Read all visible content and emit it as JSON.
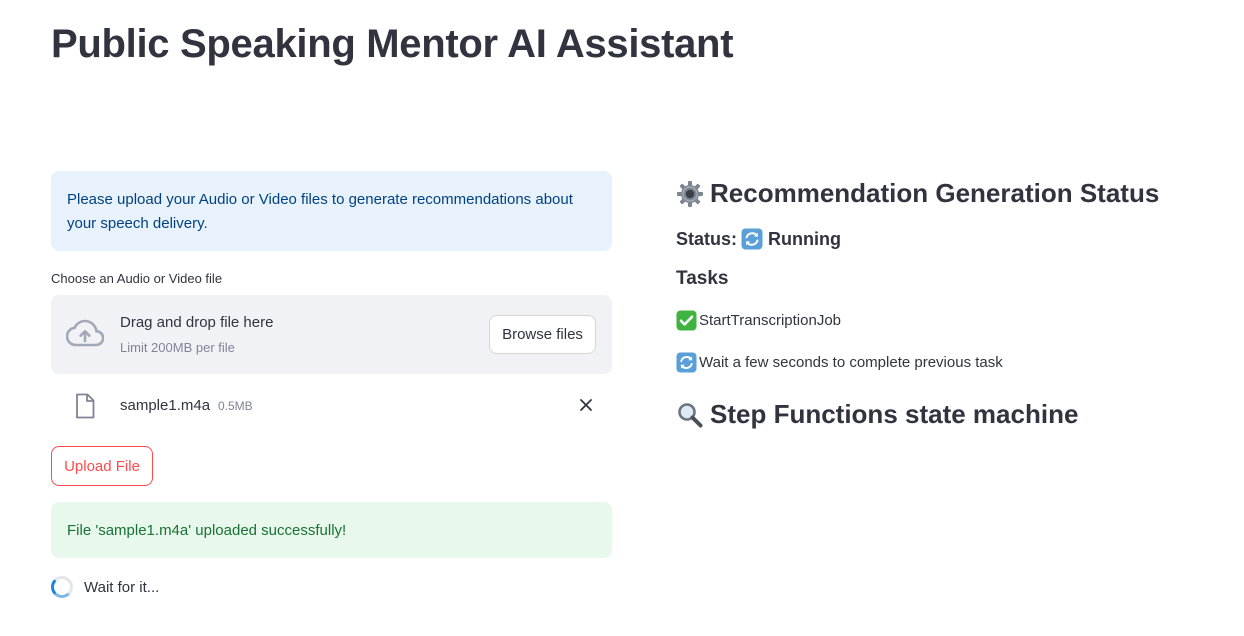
{
  "page": {
    "title": "Public Speaking Mentor AI Assistant"
  },
  "left": {
    "info_text": "Please upload your Audio or Video files to generate recommendations about your speech delivery.",
    "uploader_label": "Choose an Audio or Video file",
    "dropzone": {
      "title": "Drag and drop file here",
      "subtitle": "Limit 200MB per file",
      "browse_label": "Browse files",
      "icon": "cloud-upload-icon"
    },
    "file": {
      "name": "sample1.m4a",
      "size": "0.5MB",
      "icon": "file-icon"
    },
    "upload_button": "Upload File",
    "success_text": "File 'sample1.m4a' uploaded successfully!",
    "spinner_text": "Wait for it..."
  },
  "right": {
    "status_heading": "Recommendation Generation Status",
    "status_prefix": "Status:",
    "status_value": "Running",
    "tasks_heading": "Tasks",
    "tasks": [
      {
        "icon": "check-mark-icon",
        "label": "StartTranscriptionJob"
      },
      {
        "icon": "refresh-icon",
        "label": "Wait a few seconds to complete previous task"
      }
    ],
    "state_machine_heading": "Step Functions state machine"
  },
  "colors": {
    "text": "#31333f",
    "info_bg": "#e8f2fc",
    "info_text": "#004280",
    "success_bg": "#e9f8ec",
    "success_text": "#177233",
    "primary": "#ff4b4b",
    "muted": "#808495"
  }
}
